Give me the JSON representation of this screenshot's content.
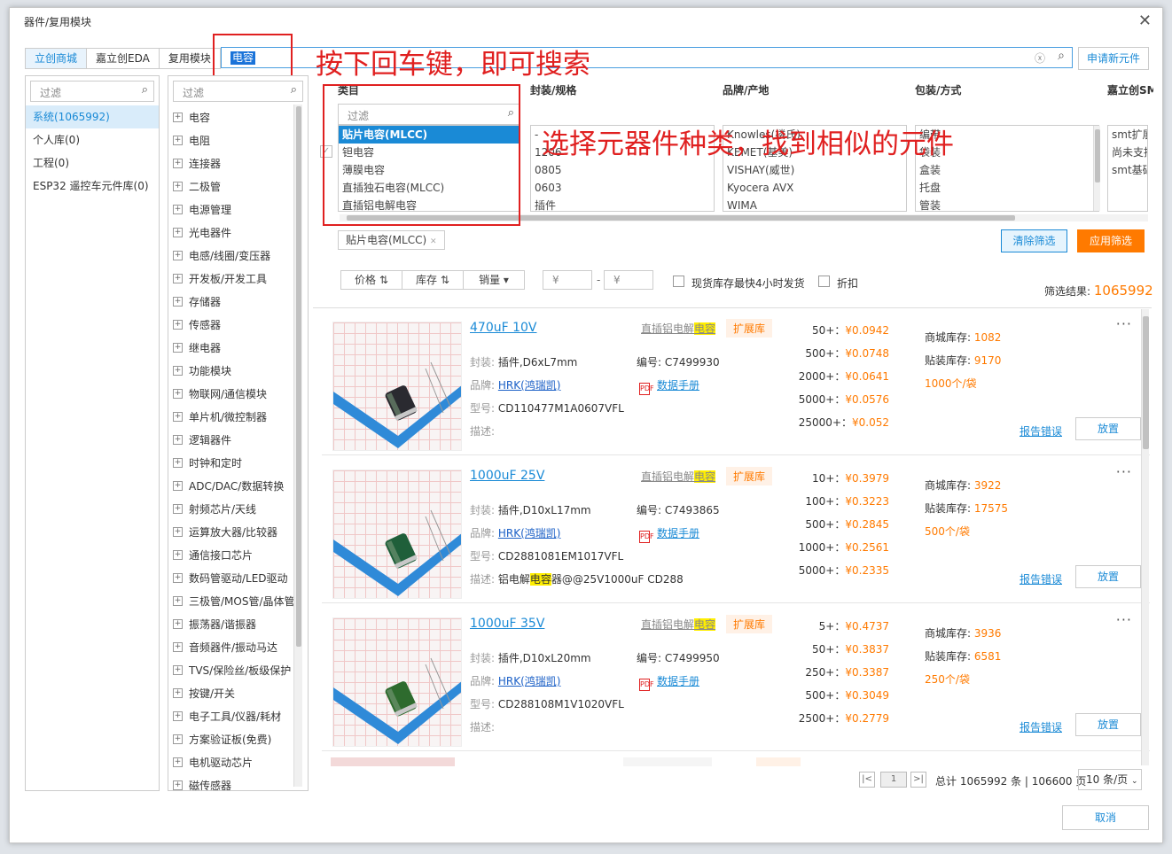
{
  "dialog": {
    "title": "器件/复用模块"
  },
  "tabs": [
    "立创商城",
    "嘉立创EDA",
    "复用模块"
  ],
  "search": {
    "value": "电容",
    "request_new": "申请新元件"
  },
  "annotations": {
    "search": "按下回车键，即可搜索",
    "category": "选择元器件种类，找到相似的元件"
  },
  "filter_placeholder": "过滤",
  "libraries": [
    "系统(1065992)",
    "个人库(0)",
    "工程(0)",
    "ESP32 遥控车元件库(0)"
  ],
  "categories": [
    "电容",
    "电阻",
    "连接器",
    "二极管",
    "电源管理",
    "光电器件",
    "电感/线圈/变压器",
    "开发板/开发工具",
    "存储器",
    "传感器",
    "继电器",
    "功能模块",
    "物联网/通信模块",
    "单片机/微控制器",
    "逻辑器件",
    "时钟和定时",
    "ADC/DAC/数据转换",
    "射频芯片/天线",
    "运算放大器/比较器",
    "通信接口芯片",
    "数码管驱动/LED驱动",
    "三极管/MOS管/晶体管",
    "振荡器/谐振器",
    "音频器件/振动马达",
    "TVS/保险丝/板级保护",
    "按键/开关",
    "电子工具/仪器/耗材",
    "方案验证板(免费)",
    "电机驱动芯片",
    "磁传感器"
  ],
  "facets": [
    {
      "title": "类目",
      "items": [
        "贴片电容(MLCC)",
        "钽电容",
        "薄膜电容",
        "直插独石电容(MLCC)",
        "直插铝电解电容"
      ],
      "selected": 0
    },
    {
      "title": "封装/规格",
      "items": [
        "-",
        "1206",
        "0805",
        "0603",
        "插件"
      ],
      "selected": -1
    },
    {
      "title": "品牌/产地",
      "items": [
        "Knowles(楼氏)",
        "KEMET(基美)",
        "VISHAY(威世)",
        "Kyocera AVX",
        "WIMA"
      ],
      "selected": -1
    },
    {
      "title": "包装/方式",
      "items": [
        "编带",
        "袋装",
        "盒装",
        "托盘",
        "管装"
      ],
      "selected": -1
    },
    {
      "title": "嘉立创SMT",
      "items": [
        "smt扩展",
        "尚未支持",
        "smt基础"
      ],
      "selected": -1
    }
  ],
  "selected_chip": "贴片电容(MLCC)",
  "buttons": {
    "clear": "清除筛选",
    "apply": "应用筛选",
    "cancel": "取消"
  },
  "sort": [
    "价格",
    "库存",
    "销量"
  ],
  "price_symbol": "¥",
  "options": {
    "in_stock": "现货库存最快4小时发货",
    "discount": "折扣"
  },
  "results": {
    "label": "筛选结果: ",
    "count": "1065992"
  },
  "labels": {
    "package": "封装: ",
    "brand": "品牌: ",
    "model": "型号: ",
    "desc": "描述: ",
    "code": "编号: ",
    "datasheet": "数据手册",
    "mall_stock": "商城库存: ",
    "smt_stock": "贴装库存: ",
    "report": "报告错误",
    "place": "放置",
    "tag_a": "直插铝电解",
    "tag_a_hl": "电容",
    "tag_b": "扩展库",
    "more": "···"
  },
  "products": [
    {
      "title": "470uF 10V",
      "package": "插件,D6xL7mm",
      "brand": "HRK(鸿瑞凯)",
      "model": "CD110477M1A0607VFL",
      "desc": "",
      "code": "C7499930",
      "prices": [
        {
          "q": "50+：",
          "v": "¥0.0942"
        },
        {
          "q": "500+：",
          "v": "¥0.0748"
        },
        {
          "q": "2000+：",
          "v": "¥0.0641"
        },
        {
          "q": "5000+：",
          "v": "¥0.0576"
        },
        {
          "q": "25000+：",
          "v": "¥0.052"
        }
      ],
      "mall_stock": "1082",
      "smt_stock": "9170",
      "pack": "1000个/袋",
      "cap_color": "#2a2a30"
    },
    {
      "title": "1000uF 25V",
      "package": "插件,D10xL17mm",
      "brand": "HRK(鸿瑞凯)",
      "model": "CD2881081EM1017VFL",
      "desc_pre": "铝电解",
      "desc_hl": "电容",
      "desc_post": "器@@25V1000uF CD288",
      "code": "C7493865",
      "prices": [
        {
          "q": "10+：",
          "v": "¥0.3979"
        },
        {
          "q": "100+：",
          "v": "¥0.3223"
        },
        {
          "q": "500+：",
          "v": "¥0.2845"
        },
        {
          "q": "1000+：",
          "v": "¥0.2561"
        },
        {
          "q": "5000+：",
          "v": "¥0.2335"
        }
      ],
      "mall_stock": "3922",
      "smt_stock": "17575",
      "pack": "500个/袋",
      "cap_color": "#1f5f3a"
    },
    {
      "title": "1000uF 35V",
      "package": "插件,D10xL20mm",
      "brand": "HRK(鸿瑞凯)",
      "model": "CD288108M1V1020VFL",
      "desc": "",
      "code": "C7499950",
      "prices": [
        {
          "q": "5+：",
          "v": "¥0.4737"
        },
        {
          "q": "50+：",
          "v": "¥0.3837"
        },
        {
          "q": "250+：",
          "v": "¥0.3387"
        },
        {
          "q": "500+：",
          "v": "¥0.3049"
        },
        {
          "q": "2500+：",
          "v": "¥0.2779"
        }
      ],
      "mall_stock": "3936",
      "smt_stock": "6581",
      "pack": "250个/袋",
      "cap_color": "#2e6b2e"
    }
  ],
  "pagination": {
    "page": "1",
    "summary": "总计 1065992 条 | 106600 页",
    "page_size": "10 条/页"
  }
}
